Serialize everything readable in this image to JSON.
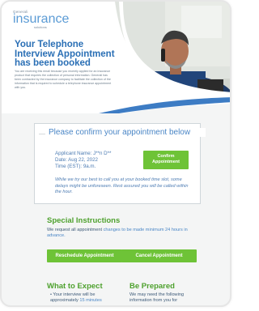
{
  "hero": {
    "logo_small": "Generali",
    "logo_big": "insurance",
    "logo_sub": "solutions",
    "title": "Your Telephone Interview Appointment has been booked",
    "lead": "You are receiving this email because you recently applied for an insurance product that requires the collection of personal information. Generali has been contracted by the insurance company to facilitate the collection of the information that is required to schedule a telephone insurance appointment with you."
  },
  "card": {
    "title": "Please confirm your appointment below",
    "applicant": "Applicant Name: J**n D**",
    "date": "Date: Aug 22, 2022",
    "time": "Time (EST): 9a.m.",
    "confirm_button": "Confirm Appointment",
    "note": "While we try our best to call you at your booked time slot, some delays might be unforeseen. Rest assured you will be called within the hour."
  },
  "special": {
    "title": "Special Instructions",
    "body_pre": "We request all appointment ",
    "body_link": "changes to be made minimum 24 hours in advance.",
    "reschedule_button": "Reschedule Appointment",
    "cancel_button": "Cancel Appointment"
  },
  "expect": {
    "title": "What to Expect",
    "body_pre": "Your interview will be approximately ",
    "body_link": "15 minutes"
  },
  "prepare": {
    "title": "Be Prepared",
    "body": "We may need the following information from you for"
  },
  "colors": {
    "accent_blue": "#4a86c6",
    "green": "#6ec337",
    "section_green": "#4ea12e"
  }
}
